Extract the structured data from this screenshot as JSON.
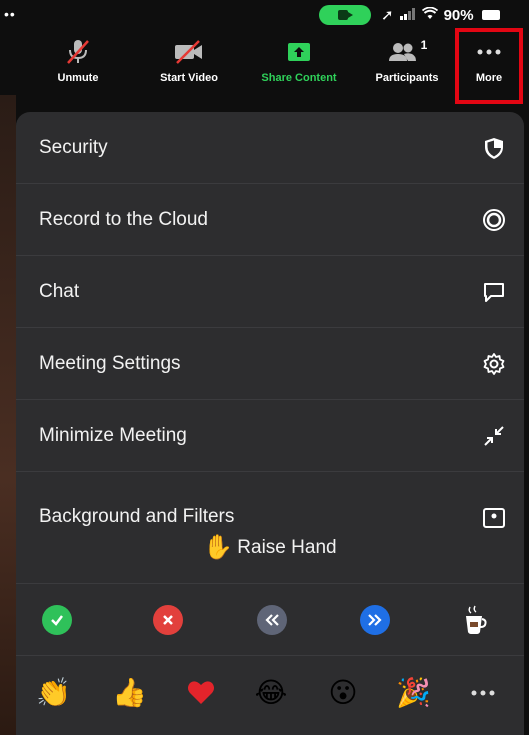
{
  "status_bar": {
    "battery": "90%"
  },
  "toolbar": {
    "unmute_label": "Unmute",
    "start_video_label": "Start Video",
    "share_content_label": "Share Content",
    "participants_label": "Participants",
    "participants_count": "1",
    "more_label": "More"
  },
  "menu": {
    "items": [
      {
        "label": "Security",
        "icon": "shield-icon"
      },
      {
        "label": "Record to the Cloud",
        "icon": "record-cloud-icon"
      },
      {
        "label": "Chat",
        "icon": "chat-icon"
      },
      {
        "label": "Meeting Settings",
        "icon": "gear-icon"
      },
      {
        "label": "Minimize Meeting",
        "icon": "minimize-icon"
      },
      {
        "label": "Background and Filters",
        "icon": "background-icon"
      }
    ]
  },
  "raise_hand": {
    "label": "Raise Hand"
  },
  "reactions": {
    "feedback": [
      "yes-icon",
      "no-icon",
      "slower-icon",
      "faster-icon",
      "coffee-icon"
    ],
    "emoji": [
      "clapping-hands-icon",
      "thumbs-up-icon",
      "heart-icon",
      "laughing-icon",
      "surprised-icon",
      "party-popper-icon",
      "more-reactions-icon"
    ]
  },
  "colors": {
    "accent_green": "#2fd15a",
    "highlight_red": "#e30613",
    "panel_bg": "#2d2d2f"
  }
}
